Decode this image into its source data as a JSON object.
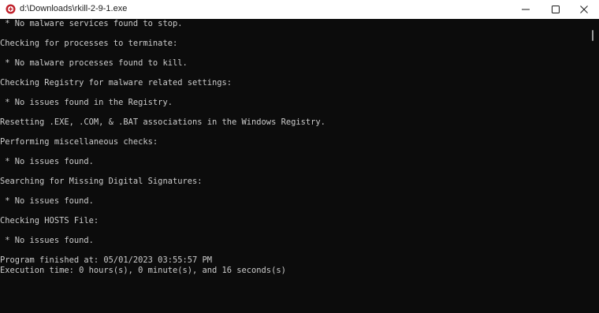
{
  "window": {
    "title": "d:\\Downloads\\rkill-2-9-1.exe",
    "app_icon": "rkill-app-icon",
    "controls": {
      "minimize_icon": "minimize-icon",
      "maximize_icon": "maximize-icon",
      "close_icon": "close-icon"
    },
    "colors": {
      "titlebar_bg": "#ffffff",
      "console_bg": "#0c0c0c",
      "console_fg": "#cccccc"
    }
  },
  "console": {
    "lines": [
      " * No malware services found to stop.",
      "",
      "Checking for processes to terminate:",
      "",
      " * No malware processes found to kill.",
      "",
      "Checking Registry for malware related settings:",
      "",
      " * No issues found in the Registry.",
      "",
      "Resetting .EXE, .COM, & .BAT associations in the Windows Registry.",
      "",
      "Performing miscellaneous checks:",
      "",
      " * No issues found.",
      "",
      "Searching for Missing Digital Signatures:",
      "",
      " * No issues found.",
      "",
      "Checking HOSTS File:",
      "",
      " * No issues found.",
      "",
      "Program finished at: 05/01/2023 03:55:57 PM",
      "Execution time: 0 hours(s), 0 minute(s), and 16 seconds(s)"
    ]
  }
}
